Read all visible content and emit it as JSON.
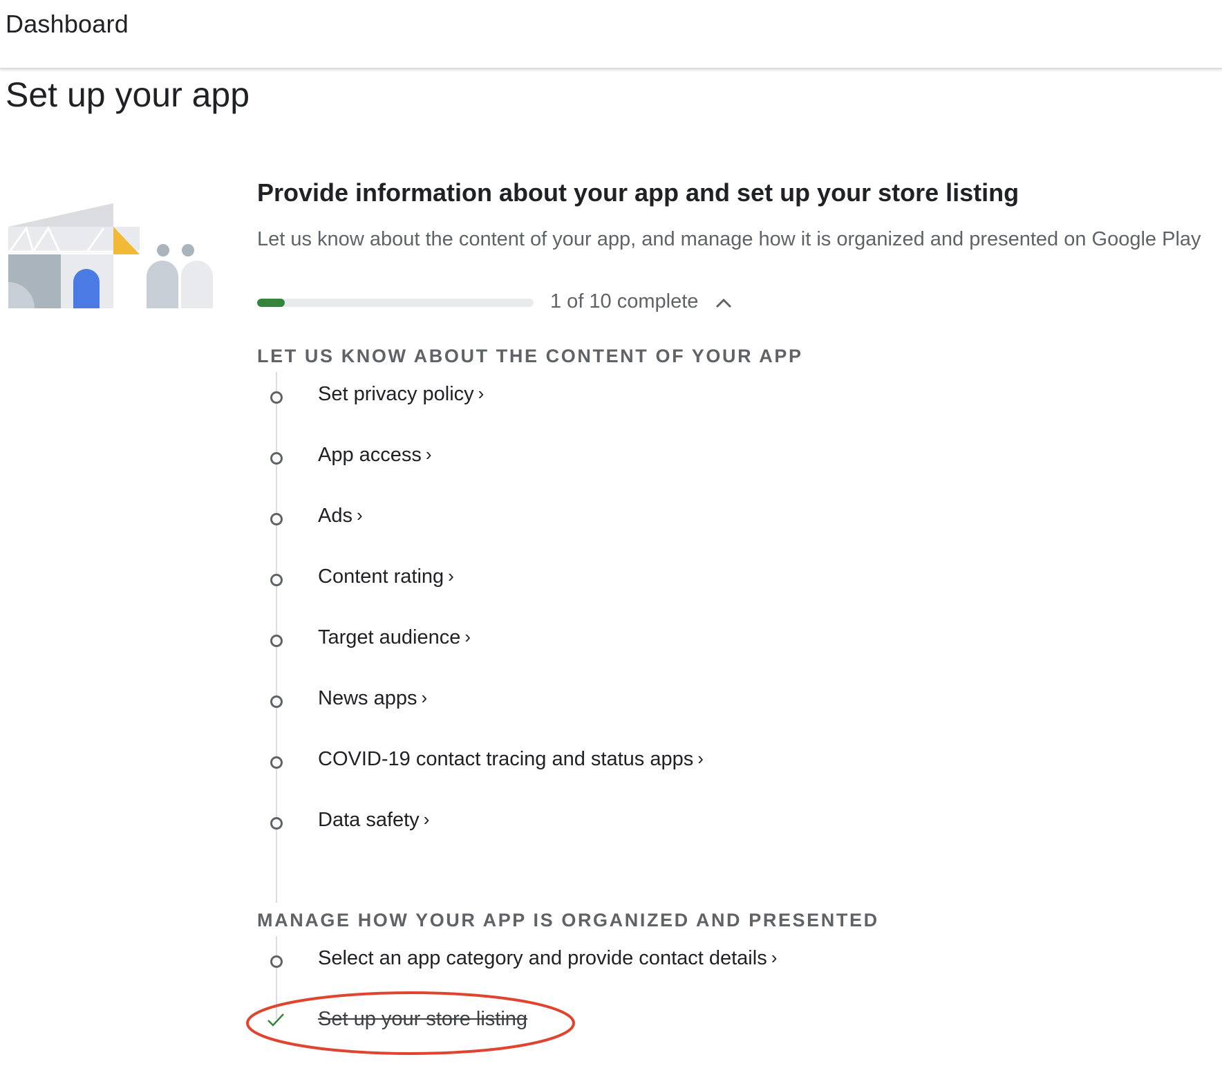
{
  "header": {
    "title": "Dashboard"
  },
  "page": {
    "title": "Set up your app"
  },
  "card": {
    "title": "Provide information about your app and set up your store listing",
    "description": "Let us know about the content of your app, and manage how it is organized and presented on Google Play",
    "progress": {
      "completed": 1,
      "total": 10,
      "fraction": 0.1,
      "text": "1 of 10 complete"
    }
  },
  "sections": [
    {
      "heading": "LET US KNOW ABOUT THE CONTENT OF YOUR APP",
      "tasks": [
        {
          "label": "Set privacy policy",
          "done": false
        },
        {
          "label": "App access",
          "done": false
        },
        {
          "label": "Ads",
          "done": false
        },
        {
          "label": "Content rating",
          "done": false
        },
        {
          "label": "Target audience",
          "done": false
        },
        {
          "label": "News apps",
          "done": false
        },
        {
          "label": "COVID-19 contact tracing and status apps",
          "done": false
        },
        {
          "label": "Data safety",
          "done": false
        }
      ]
    },
    {
      "heading": "MANAGE HOW YOUR APP IS ORGANIZED AND PRESENTED",
      "tasks": [
        {
          "label": "Select an app category and provide contact details",
          "done": false
        },
        {
          "label": "Set up your store listing",
          "done": true
        }
      ]
    }
  ],
  "icons": {
    "chevron": "chevron-right-icon",
    "collapse": "chevron-up-icon",
    "check": "check-icon",
    "pending": "circle-outline-icon"
  },
  "colors": {
    "progress_fill": "#34843c",
    "check": "#34843c",
    "highlight_ring": "#e0442e",
    "illustration_blue": "#4a7be5",
    "illustration_yellow": "#f2b936"
  }
}
